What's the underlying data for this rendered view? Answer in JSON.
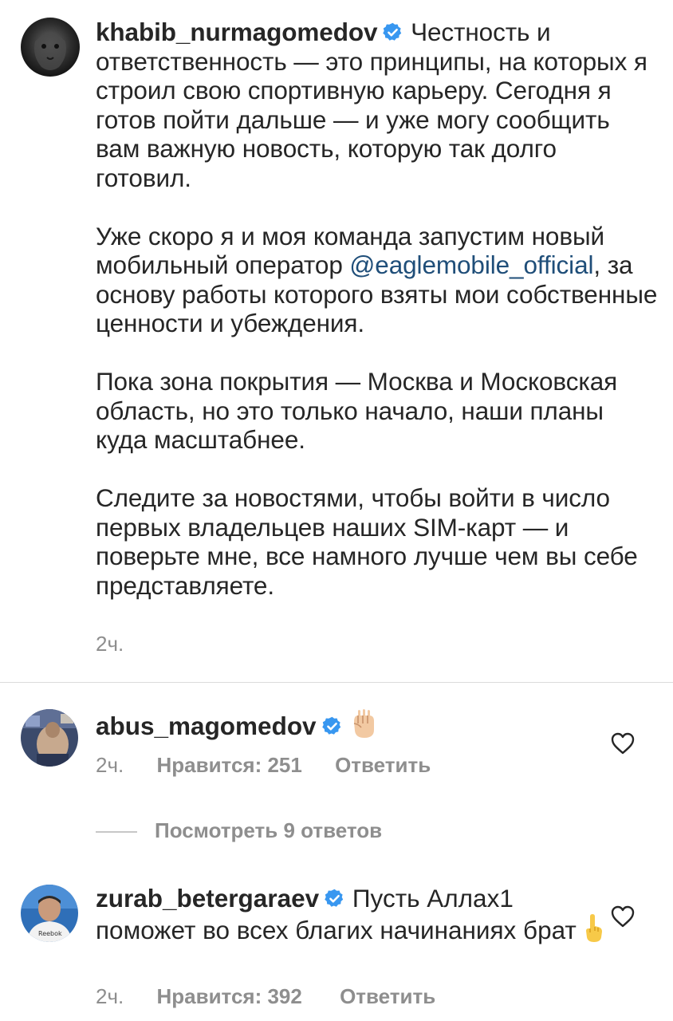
{
  "post": {
    "username": "khabib_nurmagomedov",
    "text_intro": "Честность и ответственность — это принципы, на которых я строил свою спортивную карьеру. Сегодня я готов пойти дальше — и уже могу сообщить вам важную новость, которую так долго готовил.",
    "para2_before": "Уже скоро я и моя команда запустим новый мобильный оператор ",
    "para2_mention": "@eaglemobile_official",
    "para2_after": ", за основу работы которого взяты мои собственные ценности и убеждения.",
    "para3": "Пока зона покрытия — Москва и Московская область, но это только начало, наши планы куда масштабнее.",
    "para4": "Следите за новостями, чтобы войти в число первых владельцев наших SIM-карт — и поверьте мне, все намного лучше чем вы себе представляете.",
    "time": "2ч."
  },
  "comments": [
    {
      "username": "abus_magomedov",
      "text": "",
      "emoji": "raised-fist-emoji",
      "time": "2ч.",
      "likes": "Нравится: 251",
      "reply": "Ответить",
      "view_replies": "Посмотреть 9 ответов"
    },
    {
      "username": "zurab_betergaraev",
      "text": "Пусть Аллах1 поможет во всех благих начинаниях брат",
      "emoji": "pointing-up-emoji",
      "time": "2ч.",
      "likes": "Нравится: 392",
      "reply": "Ответить"
    }
  ],
  "colors": {
    "verified": "#3897f0",
    "mention": "#1f4e79",
    "meta": "#8e8e8e",
    "text": "#262626"
  }
}
